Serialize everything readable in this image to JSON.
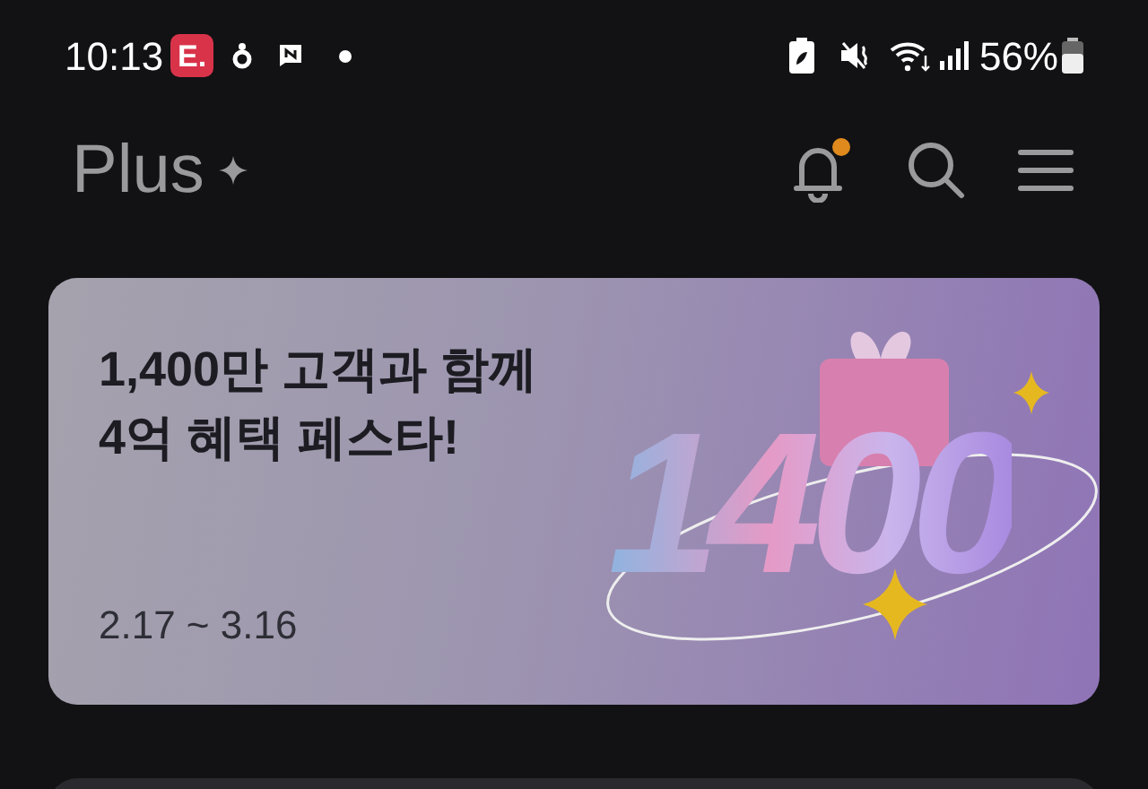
{
  "status_bar": {
    "time": "10:13",
    "app_badge": "E.",
    "battery": "56%"
  },
  "header": {
    "title": "Plus",
    "notification_dot": true
  },
  "banner": {
    "headline": [
      "1,400만 고객과 함께",
      "4억 혜택 페스타!"
    ],
    "period": "2.17 ~ 3.16",
    "illustration_text": "1400"
  }
}
